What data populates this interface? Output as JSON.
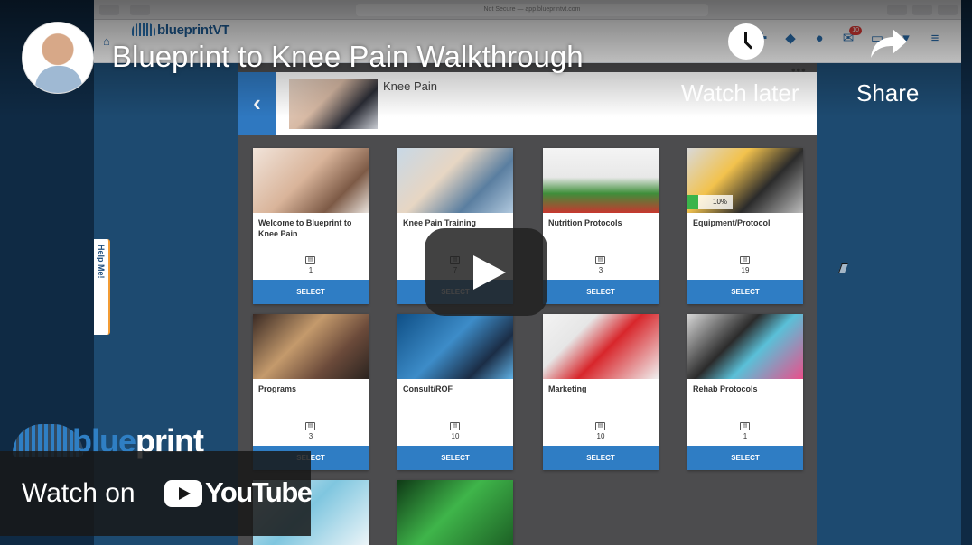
{
  "browser": {
    "url": "Not Secure — app.blueprintvt.com"
  },
  "app": {
    "logo_text": "blueprintVT",
    "notifications_badge": "10",
    "help_tab": "Help Me!",
    "section": {
      "title": "Knee Pain",
      "back_icon": "chevron-left-icon",
      "more_icon": "more-dots-icon"
    },
    "cards": [
      {
        "title": "Welcome to Blueprint to Knee Pain",
        "count": "1",
        "select": "SELECT"
      },
      {
        "title": "Knee Pain Training",
        "count": "7",
        "select": "SELECT"
      },
      {
        "title": "Nutrition Protocols",
        "count": "3",
        "select": "SELECT"
      },
      {
        "title": "Equipment/Protocol",
        "count": "19",
        "select": "SELECT",
        "progress": "10%"
      },
      {
        "title": "Programs",
        "count": "3",
        "select": "SELECT"
      },
      {
        "title": "Consult/ROF",
        "count": "10",
        "select": "SELECT"
      },
      {
        "title": "Marketing",
        "count": "10",
        "select": "SELECT"
      },
      {
        "title": "Rehab Protocols",
        "count": "1",
        "select": "SELECT"
      }
    ],
    "colors": {
      "select_blue": "#2f7dc4",
      "progress_green": "#3bb44a",
      "help_accent": "#f39c34"
    }
  },
  "youtube": {
    "video_title": "Blueprint to Knee Pain Walkthrough",
    "watch_later_label": "Watch later",
    "share_label": "Share",
    "watch_on_label": "Watch on",
    "youtube_wordmark": "YouTube",
    "brand_wordmark_part1": "blue",
    "brand_wordmark_part2": "print"
  }
}
